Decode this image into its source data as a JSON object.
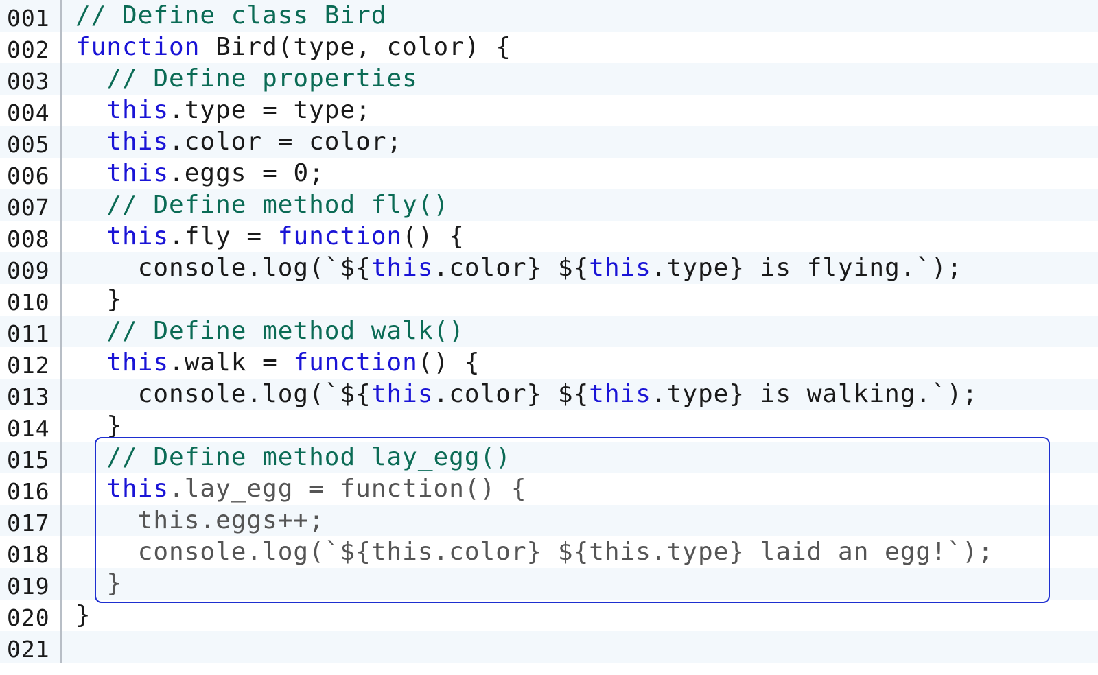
{
  "colors": {
    "keyword": "#1a14d6",
    "comment": "#0b6b55",
    "text": "#1a1a1a",
    "dimmed_text": "#555555",
    "selection_border": "#1e2fd0",
    "stripe": "#f3f8fc"
  },
  "lines": [
    {
      "num": "001",
      "tokens": [
        {
          "t": "// Define class Bird",
          "c": "cm"
        }
      ]
    },
    {
      "num": "002",
      "tokens": [
        {
          "t": "function",
          "c": "kw"
        },
        {
          "t": " Bird(type, color) {",
          "c": ""
        }
      ]
    },
    {
      "num": "003",
      "tokens": [
        {
          "t": "  // Define properties",
          "c": "cm"
        }
      ]
    },
    {
      "num": "004",
      "tokens": [
        {
          "t": "  ",
          "c": ""
        },
        {
          "t": "this",
          "c": "kw"
        },
        {
          "t": ".type = type;",
          "c": ""
        }
      ]
    },
    {
      "num": "005",
      "tokens": [
        {
          "t": "  ",
          "c": ""
        },
        {
          "t": "this",
          "c": "kw"
        },
        {
          "t": ".color = color;",
          "c": ""
        }
      ]
    },
    {
      "num": "006",
      "tokens": [
        {
          "t": "  ",
          "c": ""
        },
        {
          "t": "this",
          "c": "kw"
        },
        {
          "t": ".eggs = 0;",
          "c": ""
        }
      ]
    },
    {
      "num": "007",
      "tokens": [
        {
          "t": "  // Define method fly()",
          "c": "cm"
        }
      ]
    },
    {
      "num": "008",
      "tokens": [
        {
          "t": "  ",
          "c": ""
        },
        {
          "t": "this",
          "c": "kw"
        },
        {
          "t": ".fly = ",
          "c": ""
        },
        {
          "t": "function",
          "c": "kw"
        },
        {
          "t": "() {",
          "c": ""
        }
      ]
    },
    {
      "num": "009",
      "tokens": [
        {
          "t": "    console.log(`${",
          "c": ""
        },
        {
          "t": "this",
          "c": "kw"
        },
        {
          "t": ".color} ${",
          "c": ""
        },
        {
          "t": "this",
          "c": "kw"
        },
        {
          "t": ".type} is flying.`);",
          "c": ""
        }
      ]
    },
    {
      "num": "010",
      "tokens": [
        {
          "t": "  }",
          "c": ""
        }
      ]
    },
    {
      "num": "011",
      "tokens": [
        {
          "t": "  // Define method walk()",
          "c": "cm"
        }
      ]
    },
    {
      "num": "012",
      "tokens": [
        {
          "t": "  ",
          "c": ""
        },
        {
          "t": "this",
          "c": "kw"
        },
        {
          "t": ".walk = ",
          "c": ""
        },
        {
          "t": "function",
          "c": "kw"
        },
        {
          "t": "() {",
          "c": ""
        }
      ]
    },
    {
      "num": "013",
      "tokens": [
        {
          "t": "    console.log(`${",
          "c": ""
        },
        {
          "t": "this",
          "c": "kw"
        },
        {
          "t": ".color} ${",
          "c": ""
        },
        {
          "t": "this",
          "c": "kw"
        },
        {
          "t": ".type} is walking.`);",
          "c": ""
        }
      ]
    },
    {
      "num": "014",
      "tokens": [
        {
          "t": "  }",
          "c": ""
        }
      ]
    },
    {
      "num": "015",
      "tokens": [
        {
          "t": "  // Define method lay_egg()",
          "c": "cm"
        }
      ]
    },
    {
      "num": "016",
      "tokens": [
        {
          "t": "  ",
          "c": ""
        },
        {
          "t": "this",
          "c": "kw"
        },
        {
          "t": ".lay_egg = function() {",
          "c": "dim"
        }
      ]
    },
    {
      "num": "017",
      "tokens": [
        {
          "t": "    this.eggs++;",
          "c": "dim"
        }
      ]
    },
    {
      "num": "018",
      "tokens": [
        {
          "t": "    console.log(`${this.color} ${this.type} laid an egg!`);",
          "c": "dim"
        }
      ]
    },
    {
      "num": "019",
      "tokens": [
        {
          "t": "  }",
          "c": "dim"
        }
      ]
    },
    {
      "num": "020",
      "tokens": [
        {
          "t": "}",
          "c": ""
        }
      ]
    },
    {
      "num": "021",
      "tokens": [
        {
          "t": "",
          "c": ""
        }
      ]
    }
  ]
}
